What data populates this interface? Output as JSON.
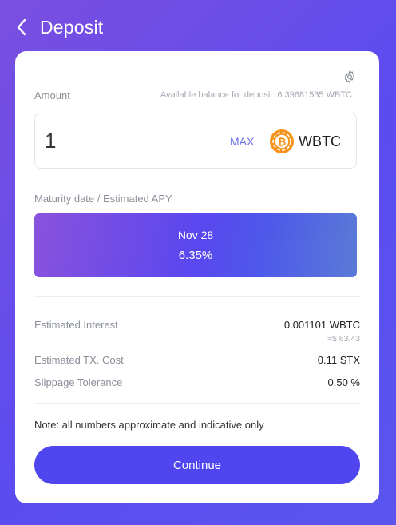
{
  "header": {
    "title": "Deposit"
  },
  "amount": {
    "label": "Amount",
    "balance_text": "Available balance for deposit: 6.39681535 WBTC",
    "value": "1",
    "max_label": "MAX",
    "token": "WBTC"
  },
  "maturity": {
    "label": "Maturity date / Estimated APY",
    "date": "Nov 28",
    "apy": "6.35%"
  },
  "details": {
    "interest_label": "Estimated Interest",
    "interest_value": "0.001101 WBTC",
    "interest_usd": "≈$ 63.43",
    "tx_label": "Estimated TX. Cost",
    "tx_value": "0.11 STX",
    "slippage_label": "Slippage Tolerance",
    "slippage_value": "0.50 %"
  },
  "note": "Note: all numbers approximate and indicative only",
  "continue_label": "Continue",
  "colors": {
    "primary": "#5046ef",
    "btc_orange": "#f7931a"
  }
}
